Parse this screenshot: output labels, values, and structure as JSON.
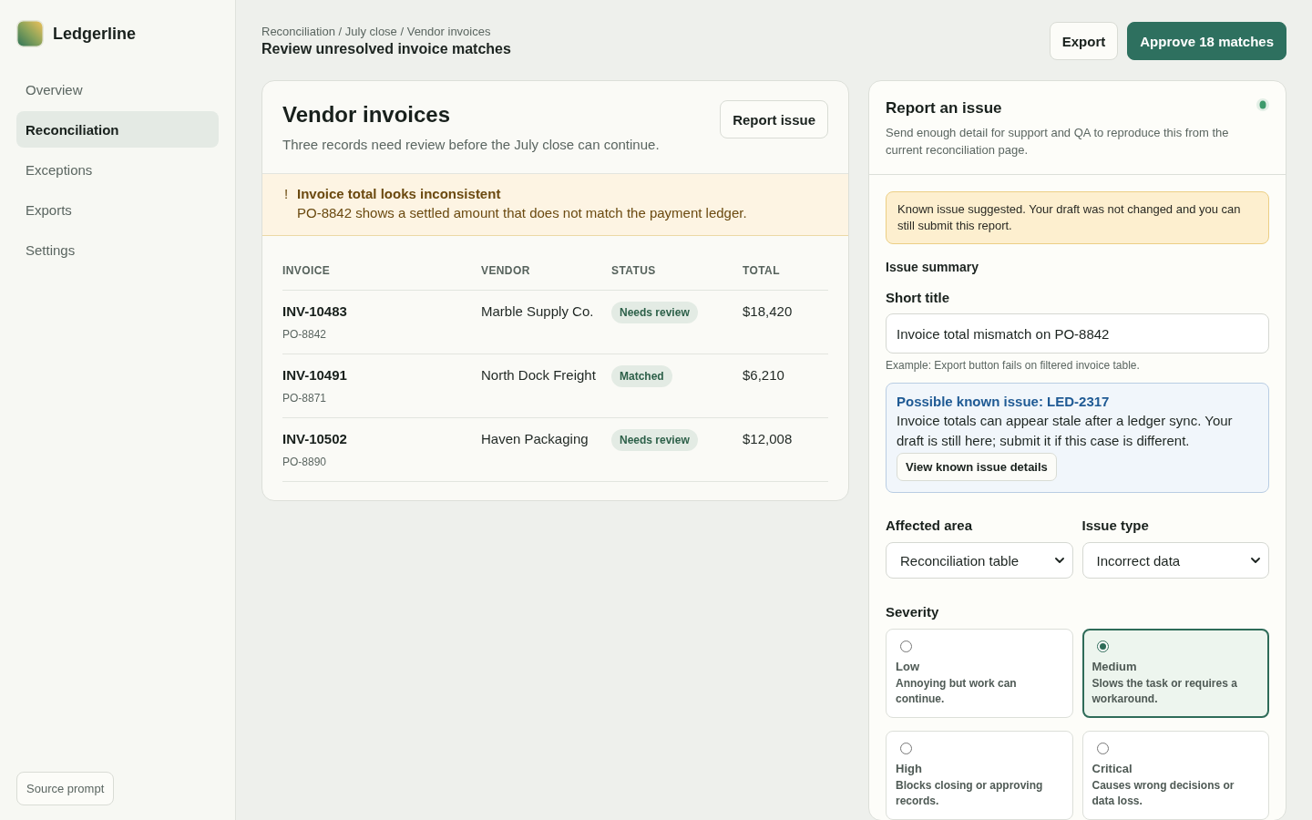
{
  "sidebar": {
    "brand": "Ledgerline",
    "items": [
      {
        "label": "Overview",
        "selected": false
      },
      {
        "label": "Reconciliation",
        "selected": true
      },
      {
        "label": "Exceptions",
        "selected": false
      },
      {
        "label": "Exports",
        "selected": false
      },
      {
        "label": "Settings",
        "selected": false
      }
    ],
    "footer_button": "Source prompt"
  },
  "header": {
    "breadcrumb": "Reconciliation / July close / Vendor invoices",
    "title": "Review unresolved invoice matches",
    "buttons": [
      {
        "label": "Export",
        "kind": "secondary"
      },
      {
        "label": "Approve 18 matches",
        "kind": "primary"
      }
    ]
  },
  "invoices_card": {
    "title": "Vendor invoices",
    "subtitle": "Three records need review before the July close can continue.",
    "action": "Report issue",
    "alert": {
      "icon": "!",
      "title": "Invoice total looks inconsistent",
      "text": "PO-8842 shows a settled amount that does not match the payment ledger."
    },
    "table": {
      "columns": [
        "INVOICE",
        "VENDOR",
        "STATUS",
        "TOTAL"
      ],
      "rows": [
        {
          "invoice": "INV-10483",
          "po": "PO-8842",
          "vendor": "Marble Supply Co.",
          "status": "Needs review",
          "total": "$18,420"
        },
        {
          "invoice": "INV-10491",
          "po": "PO-8871",
          "vendor": "North Dock Freight",
          "status": "Matched",
          "total": "$6,210"
        },
        {
          "invoice": "INV-10502",
          "po": "PO-8890",
          "vendor": "Haven Packaging",
          "status": "Needs review",
          "total": "$12,008"
        }
      ]
    }
  },
  "report_panel": {
    "title": "Report an issue",
    "description": "Send enough detail for support and QA to reproduce this from the current reconciliation page.",
    "notice": "Known issue suggested. Your draft was not changed and you can still submit this report.",
    "section_label": "Issue summary",
    "short_title": {
      "label": "Short title",
      "value": "Invoice total mismatch on PO-8842",
      "help_text": "Example: Export button fails on filtered invoice table."
    },
    "known_issue": {
      "title": "Possible known issue: LED-2317",
      "text": "Invoice totals can appear stale after a ledger sync. Your draft is still here; submit it if this case is different.",
      "button": "View known issue details"
    },
    "selects": [
      {
        "label": "Affected area",
        "value": "Reconciliation table"
      },
      {
        "label": "Issue type",
        "value": "Incorrect data"
      }
    ],
    "severity": {
      "label": "Severity",
      "options": [
        {
          "label": "Low",
          "description": "Annoying but work can continue.",
          "selected": false
        },
        {
          "label": "Medium",
          "description": "Slows the task or requires a workaround.",
          "selected": true
        },
        {
          "label": "High",
          "description": "Blocks closing or approving records.",
          "selected": false
        },
        {
          "label": "Critical",
          "description": "Causes wrong decisions or data loss.",
          "selected": false
        }
      ]
    }
  }
}
